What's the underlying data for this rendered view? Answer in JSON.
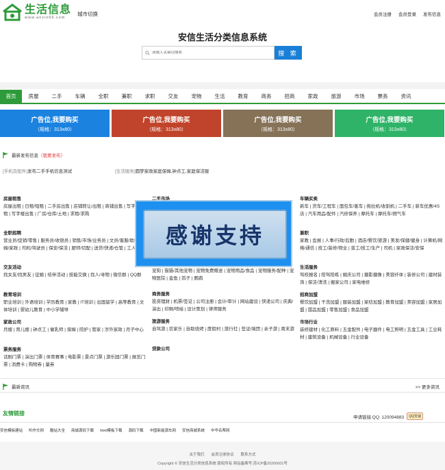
{
  "header": {
    "logo_title": "生活信息",
    "logo_url": "www.anxin66.com",
    "city_switch": "城市切换",
    "links": [
      "会员注册",
      "会员登录",
      "发布信息"
    ],
    "site_title": "安信生活分类信息系统",
    "search_placeholder": "请输入关键词搜索",
    "search_button": "搜 索"
  },
  "nav": [
    "首页",
    "房屋",
    "二手",
    "车辆",
    "全职",
    "兼职",
    "求职",
    "交友",
    "宠物",
    "生活",
    "教育",
    "商务",
    "招商",
    "家政",
    "旅游",
    "市场",
    "票务",
    "资讯"
  ],
  "ads": [
    {
      "title": "广告位,我要购买",
      "size": "（规格：313x80）",
      "color": "#1b82e0"
    },
    {
      "title": "广告位,我要购买",
      "size": "（规格：313x80）",
      "color": "#c0442b"
    },
    {
      "title": "广告位,我要购买",
      "size": "（规格：313x80）",
      "color": "#857257"
    },
    {
      "title": "广告位,我要购买",
      "size": "（规格：313x80）",
      "color": "#2fb368"
    }
  ],
  "latest": {
    "heading": "最新发布信息",
    "publish": "（我要发布）",
    "items": [
      {
        "tag": "[手机及配件]",
        "text": "发布二手手机信息测试"
      },
      {
        "tag": "[生活服务]",
        "text": "圆梦家政家庭保姆,钟点工,家庭保洁服"
      }
    ]
  },
  "categories": {
    "col1": [
      {
        "title": "房屋租售",
        "links": "房屋出租 | 日租/短租 | 二手房出售 | 店铺转让/出租 | 商铺出售 | 写字楼出租 | 写字楼出售 | 厂房/仓库/土地 | 求租/求购"
      },
      {
        "title": "全职招聘",
        "links": "营业员/促销/零售 | 服务员/收银员 | 销售/市场/业务员 | 文员/客服/助理 | 保姆/家政 | 司机/驾驶员 | 保安/保洁 | 厨师/切配 | 送货/快递/仓管 | 工人/技工"
      },
      {
        "title": "交友活动",
        "links": "找女友/找男友 | 征婚 | 结伴活动 | 技能交换 | 找人/寻物 | 微信群 | QQ群"
      },
      {
        "title": "教育培训",
        "links": "职业培训 | 外语培训 | 学历教育 | 家教 | IT培训 | 出国留学 | 高等教育 | 文体培训 | 婴幼儿教育 | 中小学辅导"
      },
      {
        "title": "家政公司",
        "links": "月嫂 | 育儿嫂 | 钟点工 | 催乳师 | 保姆 | 陪护 | 管家 | 涉外家政 | 月子中心"
      },
      {
        "title": "票务服务",
        "links": "话剧门票 | 演出门票 | 体育赛事 | 电影票 | 景点门票 | 游乐园门票 | 展览门票 | 消费卡 | 购物券 | 量券"
      }
    ],
    "col2": [
      {
        "title": "二手市场",
        "links": ""
      },
      {
        "title": "",
        "links": "宠狗 | 猫猫/其他宠物 | 宠物免费赠送 | 宠物用品/食品 | 宠物服务/配种 | 宠物医院 | 金鱼 | 鸽子 | 鹦鹉"
      },
      {
        "title": "商务服务",
        "links": "投资理财 | 机票/签证 | 公司注册 | 会计/审计 | 网站建设 | 快递公司 | 庆典/演出 | 印刷/喷绘 | 设计策划 | 律师服务"
      },
      {
        "title": "旅游服务",
        "links": "自驾游 | 农家乐 | 自助烧烤 | 度假村 | 旅行社 | 签证/境团 | 亲子游 | 周末游"
      },
      {
        "title": "贷款公司",
        "links": ""
      }
    ],
    "col3": [
      {
        "title": "车辆买卖",
        "links": "新车 | 货车/工程车 | 面包车/客车 | 拖拉机/收割机 | 二手车 | 新车优惠/4S店 | 汽车用品/配件 | 汽修保养 | 摩托车 | 摩托车/燃气车"
      },
      {
        "title": "兼职",
        "links": "家教 | 会展 | 人事/行政/后勤 | 酒店/餐饮/旅游 | 美发/保健/健身 | 计算机/网络/通信 | 技工/装修/物业 | 普工/技工/生产 | 司机 | 家政保洁/安保"
      },
      {
        "title": "生活服务",
        "links": "驾校报名 | 陪驾陪练 | 婚庆公司 | 摄影摄像 | 美容纤体 | 装修公司 | 建材装饰 | 保洁/清洗 | 搬家公司 | 家电维修"
      },
      {
        "title": "招商加盟",
        "links": "餐饮加盟 | 干洗加盟 | 服装加盟 | 家纺加盟 | 教育加盟 | 美容加盟 | 家居加盟 | 甜品加盟 | 零售加盟 | 食品加盟"
      },
      {
        "title": "市场行业",
        "links": "装修建材 | 化工原料 | 五金配件 | 电子器件 | 电工照明 | 五金工具 | 工业耗材 | 建筑设备 | 机械设备 | 行业设备"
      }
    ]
  },
  "overlay_text": "感谢支持",
  "news": {
    "heading": "最新资讯",
    "more": ">> 更多资讯"
  },
  "friend": {
    "title": "友情链接",
    "apply": "申请链接:QQ: 120094883",
    "qq_button": "QQ交谈",
    "links": [
      "安信模板建站",
      "听作文网",
      "酷站大全",
      "商城源码下载",
      "html模板下载",
      "源码下载",
      "中国新能源车网",
      "安信商城系统",
      "中华名帮网"
    ]
  },
  "footer": {
    "links": [
      "关于我们",
      "会员注册协议",
      "联系方式"
    ],
    "copyright": "Copyright © 安信生活分类信息系统  版权所有  网站备案号:苏ICP备20200001号"
  }
}
